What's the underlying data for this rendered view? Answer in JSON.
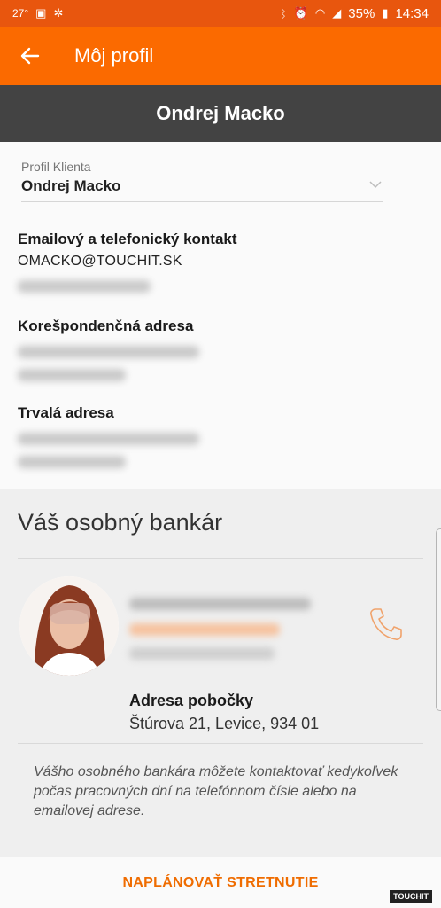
{
  "status_bar": {
    "temperature": "27°",
    "battery": "35%",
    "time": "14:34"
  },
  "app_bar": {
    "title": "Môj profil"
  },
  "profile": {
    "name_header": "Ondrej Macko",
    "select_label": "Profil Klienta",
    "select_value": "Ondrej Macko"
  },
  "contact": {
    "title": "Emailový a telefonický kontakt",
    "email": "OMACKO@TOUCHIT.SK"
  },
  "correspondence": {
    "title": "Korešpondenčná adresa"
  },
  "permanent": {
    "title": "Trvalá adresa"
  },
  "banker": {
    "title": "Váš osobný bankár",
    "branch_title": "Adresa pobočky",
    "branch_address": "Štúrova 21, Levice, 934 01",
    "note": "Vášho osobného bankára môžete kontaktovať kedykoľvek počas pracovných dní na telefónnom čísle alebo na emailovej adrese."
  },
  "action": {
    "cta": "NAPLÁNOVAŤ STRETNUTIE"
  },
  "watermark": "TOUCHIT",
  "colors": {
    "status_bar": "#e8560e",
    "app_bar": "#fb6a00",
    "accent": "#ef6c00",
    "header": "#434343"
  },
  "icons": [
    "back-arrow-icon",
    "chevron-down-icon",
    "phone-icon",
    "image-icon",
    "fan-icon",
    "bluetooth-icon",
    "alarm-icon",
    "wifi-icon",
    "signal-icon",
    "battery-icon"
  ]
}
